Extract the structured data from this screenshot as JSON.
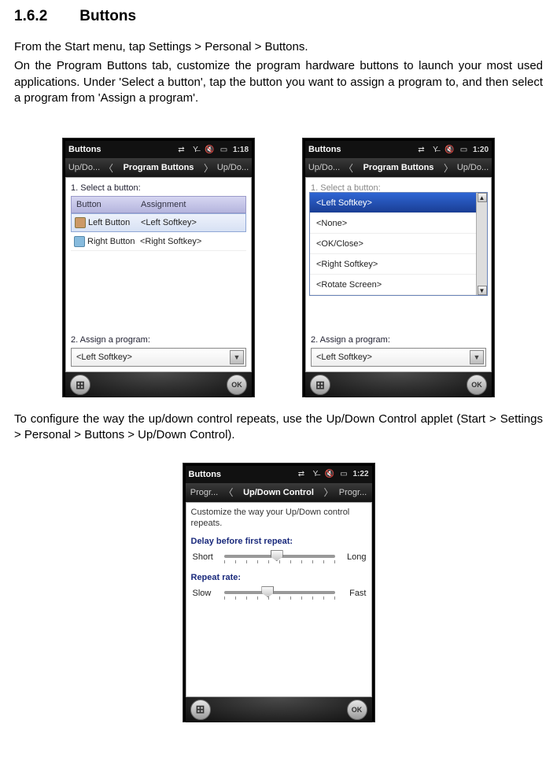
{
  "section": {
    "number": "1.6.2",
    "title": "Buttons"
  },
  "para1": "From the Start menu, tap Settings > Personal > Buttons.",
  "para2": "On the Program Buttons tab, customize the program hardware buttons to launch your most used applications. Under 'Select a button', tap the button you want to assign a program to, and then select a program from 'Assign a program'.",
  "para3": "To configure the way the up/down control repeats, use the Up/Down Control applet (Start > Settings > Personal > Buttons > Up/Down Control).",
  "screen1": {
    "title": "Buttons",
    "time": "1:18",
    "tab_left": "Up/Do...",
    "tab_center": "Program Buttons",
    "tab_right": "Up/Do...",
    "label_select": "1. Select a button:",
    "th_button": "Button",
    "th_assign": "Assignment",
    "rows": [
      {
        "name": "Left Button",
        "assign": "<Left Softkey>",
        "selected": true
      },
      {
        "name": "Right Button",
        "assign": "<Right Softkey>",
        "selected": false
      }
    ],
    "label_assign": "2. Assign a program:",
    "combo_value": "<Left Softkey>",
    "ok": "OK"
  },
  "screen2": {
    "title": "Buttons",
    "time": "1:20",
    "tab_left": "Up/Do...",
    "tab_center": "Program Buttons",
    "tab_right": "Up/Do...",
    "label_select_hidden": "1. Select a button:",
    "options": [
      {
        "text": "<Left Softkey>",
        "selected": true
      },
      {
        "text": "<None>",
        "selected": false
      },
      {
        "text": "<OK/Close>",
        "selected": false
      },
      {
        "text": "<Right Softkey>",
        "selected": false
      },
      {
        "text": "<Rotate Screen>",
        "selected": false
      }
    ],
    "label_assign": "2. Assign a program:",
    "combo_value": "<Left Softkey>",
    "ok": "OK"
  },
  "screen3": {
    "title": "Buttons",
    "time": "1:22",
    "tab_left": "Progr...",
    "tab_center": "Up/Down Control",
    "tab_right": "Progr...",
    "customize": "Customize the way your Up/Down control repeats.",
    "delay_label": "Delay before first repeat:",
    "delay_short": "Short",
    "delay_long": "Long",
    "rate_label": "Repeat rate:",
    "rate_slow": "Slow",
    "rate_fast": "Fast",
    "ok": "OK"
  }
}
